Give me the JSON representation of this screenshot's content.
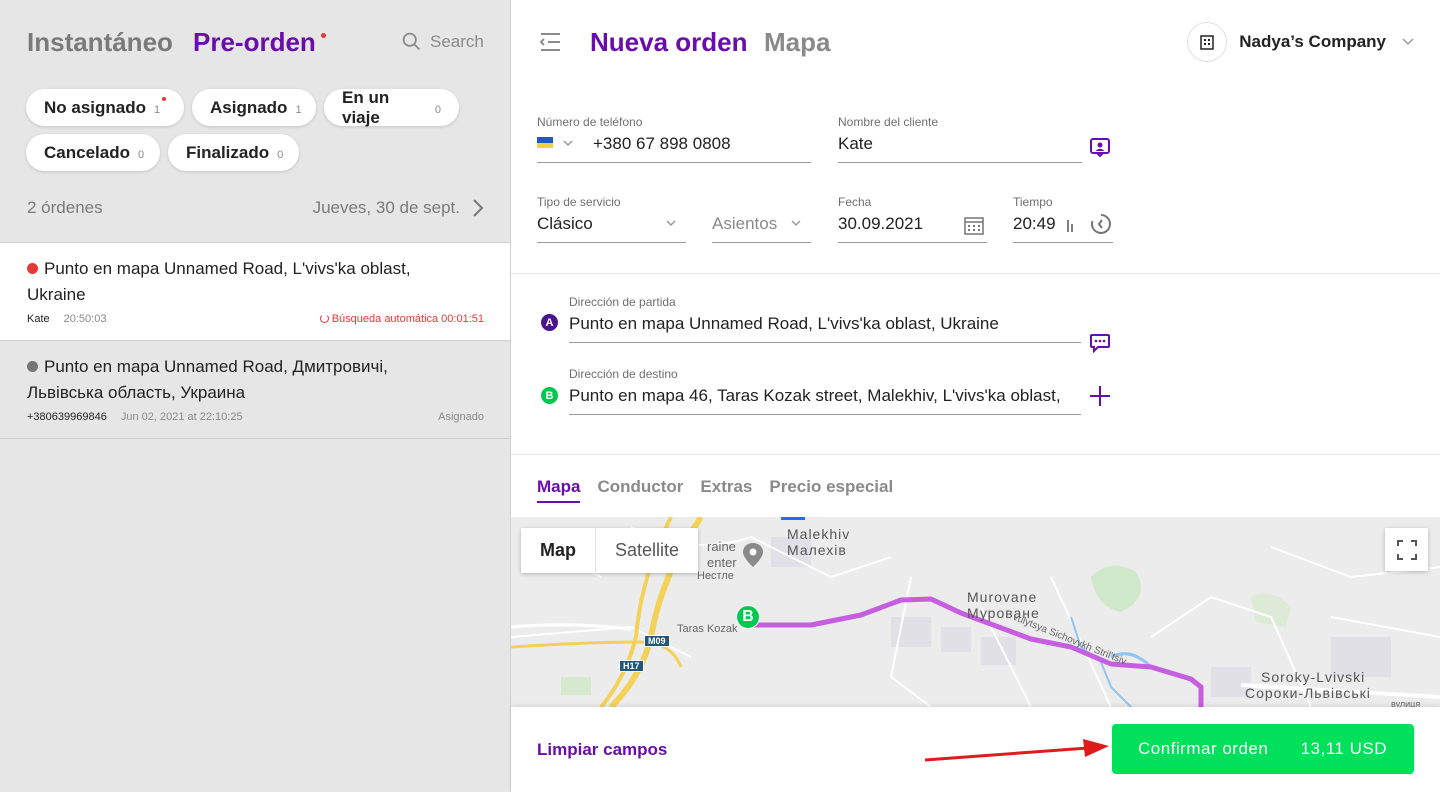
{
  "left": {
    "tabs": {
      "instant": "Instantáneo",
      "preorder": "Pre-orden"
    },
    "search_label": "Search",
    "chips": [
      {
        "label": "No asignado",
        "count": "1"
      },
      {
        "label": "Asignado",
        "count": "1"
      },
      {
        "label": "En un viaje",
        "count": "0"
      },
      {
        "label": "Cancelado",
        "count": "0"
      },
      {
        "label": "Finalizado",
        "count": "0"
      }
    ],
    "orders_count": "2 órdenes",
    "date": "Jueves, 30 de sept.",
    "orders": [
      {
        "title": "Punto en mapa Unnamed Road, L'vivs'ka oblast, Ukraine",
        "client": "Kate",
        "time": "20:50:03",
        "status": "Búsqueda automática 00:01:51",
        "clock_color": "#e53935",
        "status_color": "#e53935"
      },
      {
        "title": "Punto en mapa Unnamed Road, Дмитровичі, Львівська область, Украина",
        "client": "+380639969846",
        "time": "Jun 02, 2021 at 22:10:25",
        "status": "Asignado",
        "clock_color": "#757575",
        "status_color": "#8a8a8a"
      }
    ]
  },
  "right": {
    "tabs": {
      "new_order": "Nueva orden",
      "map": "Mapa"
    },
    "company": "Nadya’s Company",
    "form": {
      "phone_label": "Número de teléfono",
      "phone_value": "+380 67 898 0808",
      "name_label": "Nombre del cliente",
      "name_value": "Kate",
      "service_label": "Tipo de servicio",
      "service_value": "Clásico",
      "seats_value": "Asientos",
      "date_label": "Fecha",
      "date_value": "30.09.2021",
      "time_label": "Tiempo",
      "time_value": "20:49"
    },
    "addresses": {
      "start_label": "Dirección de partida",
      "start_value": "Punto en mapa Unnamed Road, L'vivs'ka oblast, Ukraine",
      "start_pin": "A",
      "end_label": "Dirección de destino",
      "end_value": "Punto en mapa 46, Taras Kozak street, Malekhiv, L'vivs'ka oblast,",
      "end_pin": "B"
    },
    "detail_tabs": [
      "Mapa",
      "Conductor",
      "Extras",
      "Precio especial"
    ],
    "map": {
      "type_map": "Map",
      "type_satellite": "Satellite",
      "labels": {
        "malekhiv": "Malekhiv",
        "malekhiv_cyr": "Малехів",
        "murovane": "Murovane",
        "murovane_cyr": "Муроване",
        "soroky": "Soroky-Lvivski",
        "soroky_cyr": "Сороки-Львівські",
        "center_a": "raine",
        "center_b": "enter",
        "nestle": "Нестле",
        "taras": "Taras Kozak",
        "street": "vulytsya Sichovykh Stril'tsiv",
        "vulytsia": "вулиця",
        "m09": "M09",
        "h17": "H17"
      },
      "destination_marker": "B",
      "route_color": "#c65ee0"
    },
    "clear_label": "Limpiar campos",
    "confirm_label": "Confirmar orden",
    "price": "13,11 USD"
  },
  "colors": {
    "accent": "#6a0dad",
    "confirm": "#00e05a",
    "alert": "#e53935"
  }
}
